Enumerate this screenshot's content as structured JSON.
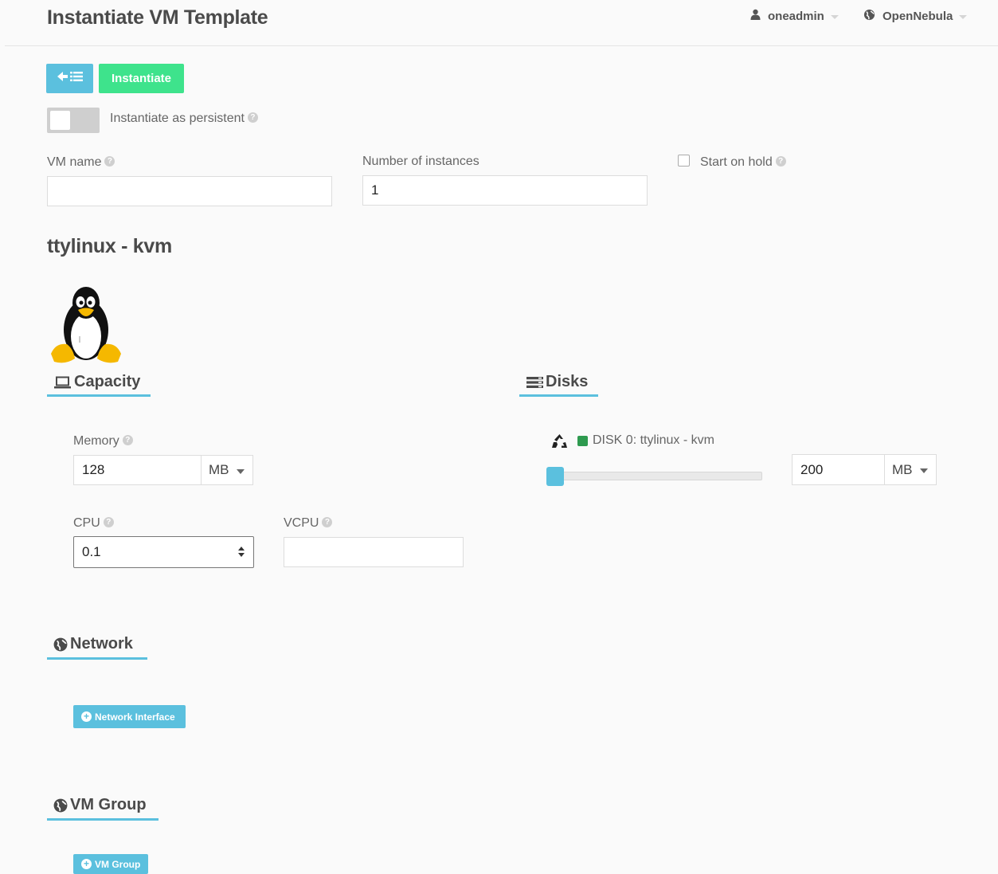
{
  "header": {
    "title": "Instantiate VM Template",
    "user_label": "oneadmin",
    "zone_label": "OpenNebula"
  },
  "toolbar": {
    "back_icon": "back-list-icon",
    "instantiate_label": "Instantiate"
  },
  "persistent": {
    "label": "Instantiate as persistent",
    "enabled": false
  },
  "form": {
    "vm_name_label": "VM name",
    "vm_name_value": "",
    "instances_label": "Number of instances",
    "instances_value": "1",
    "hold_label": "Start on hold",
    "hold_checked": false
  },
  "template": {
    "name": "ttylinux - kvm",
    "logo": "tux-penguin-logo"
  },
  "capacity": {
    "title": "Capacity",
    "memory_label": "Memory",
    "memory_value": "128",
    "memory_unit": "MB",
    "cpu_label": "CPU",
    "cpu_value": "0.1",
    "vcpu_label": "VCPU",
    "vcpu_value": ""
  },
  "disks": {
    "title": "Disks",
    "disk_label": "DISK 0: ttylinux - kvm",
    "disk_color": "#2e9a4f",
    "size_value": "200",
    "size_unit": "MB",
    "slider_fraction": 0.0
  },
  "network": {
    "title": "Network",
    "add_button": "Network Interface"
  },
  "vmgroup": {
    "title": "VM Group",
    "add_button": "VM Group"
  },
  "colors": {
    "accent": "#5bc0de",
    "success": "#3ee38c"
  }
}
